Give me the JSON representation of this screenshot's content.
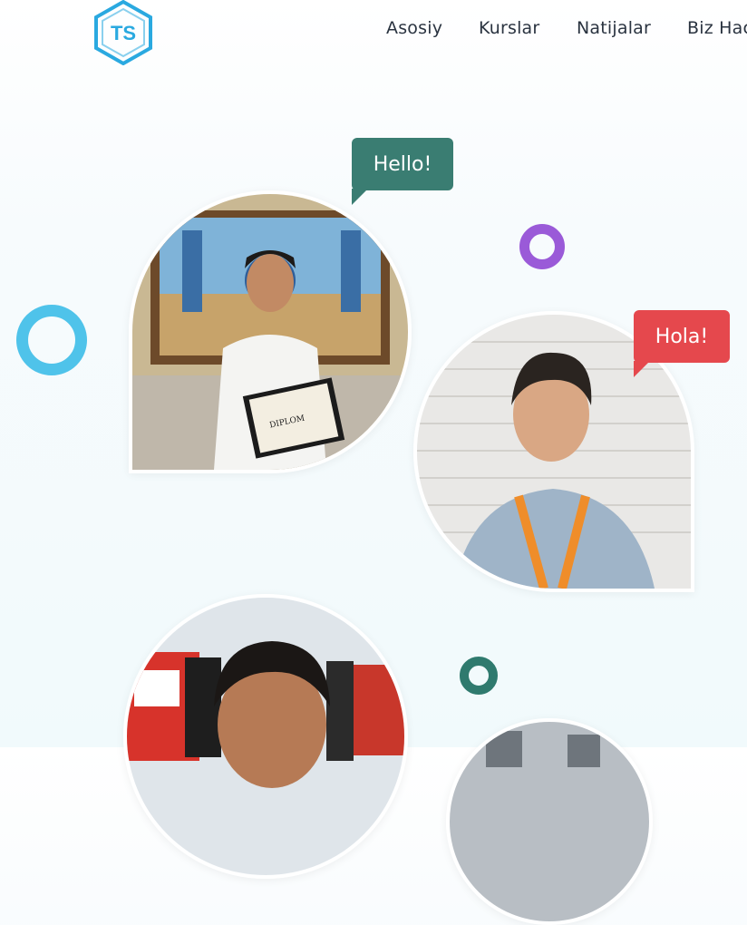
{
  "header": {
    "logo_icon": "ts-hexagon-logo-icon",
    "logo_text": "TS",
    "nav": [
      {
        "label": "Asosiy"
      },
      {
        "label": "Kurslar"
      },
      {
        "label": "Natijalar"
      },
      {
        "label": "Biz Hac"
      }
    ]
  },
  "hero": {
    "greetings": [
      {
        "text": "Hello!",
        "color": "#3a7d72"
      },
      {
        "text": "Hola!",
        "color": "#e5484d"
      }
    ],
    "photos": [
      {
        "subject": "man-with-diploma-photo",
        "diploma_title": "DIPLOM"
      },
      {
        "subject": "boy-with-lanyard-photo"
      },
      {
        "subject": "young-man-with-books-photo"
      },
      {
        "subject": "partial-photo"
      }
    ],
    "rings": [
      {
        "color": "#4fc3ea"
      },
      {
        "color": "#9a5ad8"
      },
      {
        "color": "#2f7a6e"
      }
    ]
  },
  "colors": {
    "nav_text": "#2a3340",
    "logo": "#2aa9e0"
  }
}
